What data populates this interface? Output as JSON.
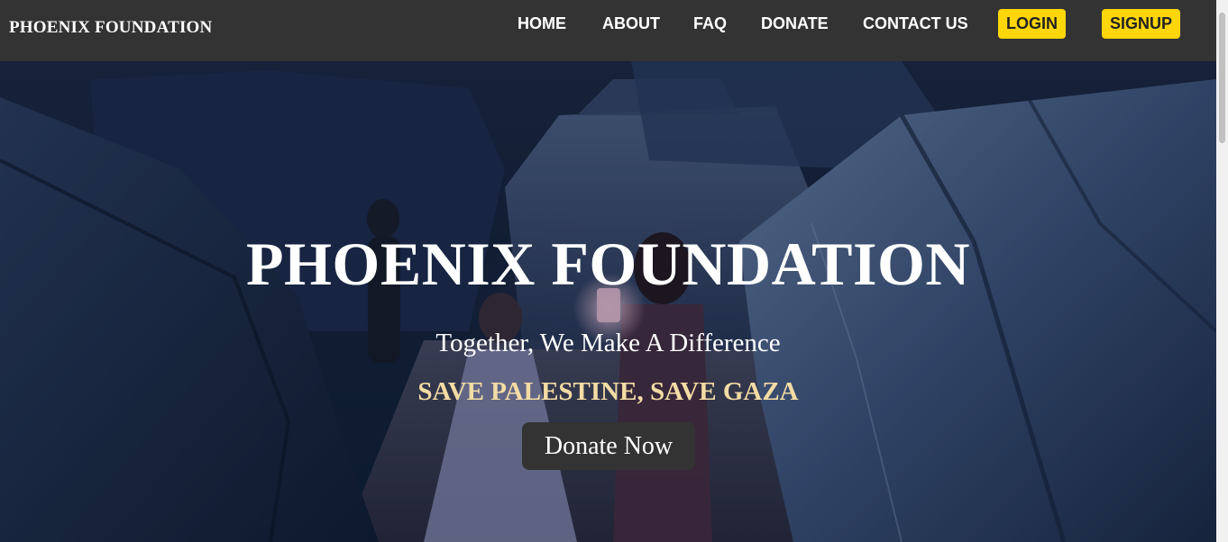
{
  "navbar": {
    "brand": "PHOENIX FOUNDATION",
    "links": [
      "HOME",
      "ABOUT",
      "FAQ",
      "DONATE",
      "CONTACT US"
    ],
    "login_label": "LOGIN",
    "signup_label": "SIGNUP"
  },
  "hero": {
    "title": "PHOENIX FOUNDATION",
    "tagline": "Together, We Make A Difference",
    "slogan": "SAVE PALESTINE, SAVE GAZA",
    "cta_label": "Donate Now"
  },
  "colors": {
    "navbar_bg": "#333333",
    "accent_button": "#ffd60a",
    "slogan_text": "#f3dca4",
    "cta_bg": "#333333"
  }
}
